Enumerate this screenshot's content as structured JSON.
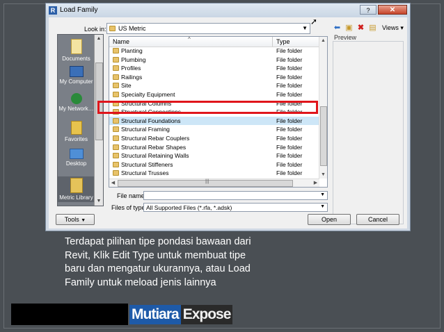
{
  "dialog": {
    "title": "Load Family",
    "help_glyph": "?",
    "close_glyph": "✕",
    "app_letter": "R"
  },
  "toolbar": {
    "look_in_label": "Look in:",
    "look_in_value": "US Metric",
    "views_label": "Views"
  },
  "preview_label": "Preview",
  "places": [
    {
      "label": "Documents",
      "icon": "documents-icon"
    },
    {
      "label": "My Computer",
      "icon": "computer-icon"
    },
    {
      "label": "My Network…",
      "icon": "network-icon"
    },
    {
      "label": "Favorites",
      "icon": "favorites-icon"
    },
    {
      "label": "Desktop",
      "icon": "desktop-icon"
    },
    {
      "label": "Metric Library",
      "icon": "library-icon"
    }
  ],
  "filelist": {
    "col_name": "Name",
    "col_type": "Type",
    "rows": [
      {
        "name": "Planting",
        "type": "File folder"
      },
      {
        "name": "Plumbing",
        "type": "File folder"
      },
      {
        "name": "Profiles",
        "type": "File folder"
      },
      {
        "name": "Railings",
        "type": "File folder"
      },
      {
        "name": "Site",
        "type": "File folder"
      },
      {
        "name": "Specialty Equipment",
        "type": "File folder"
      },
      {
        "name": "Structural Columns",
        "type": "File folder"
      },
      {
        "name": "Structural Connections",
        "type": "File folder"
      },
      {
        "name": "Structural Foundations",
        "type": "File folder"
      },
      {
        "name": "Structural Framing",
        "type": "File folder"
      },
      {
        "name": "Structural Rebar Couplers",
        "type": "File folder"
      },
      {
        "name": "Structural Rebar Shapes",
        "type": "File folder"
      },
      {
        "name": "Structural Retaining Walls",
        "type": "File folder"
      },
      {
        "name": "Structural Stiffeners",
        "type": "File folder"
      },
      {
        "name": "Structural Trusses",
        "type": "File folder"
      }
    ],
    "selected_index": 8
  },
  "form": {
    "file_name_label": "File name:",
    "file_name_value": "",
    "files_of_type_label": "Files of type:",
    "files_of_type_value": "All Supported Files  (*.rfa, *.adsk)"
  },
  "buttons": {
    "tools": "Tools",
    "open": "Open",
    "cancel": "Cancel"
  },
  "caption": "Terdapat pilihan tipe pondasi bawaan dari Revit, Klik Edit Type untuk membuat tipe baru dan mengatur ukurannya, atau Load Family untuk meload jenis lainnya",
  "brand": {
    "part1": "Mutiara",
    "part2": "Expose"
  },
  "colors": {
    "highlight": "#e0151b",
    "brand_blue": "#1e5aa8"
  }
}
